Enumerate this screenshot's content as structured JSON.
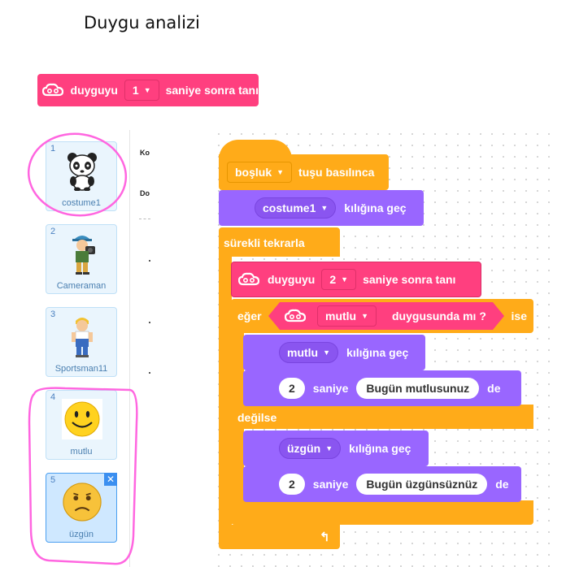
{
  "title": "Duygu analizi",
  "top_block": {
    "label_pre": "duyguyu",
    "value": "1",
    "label_post": "saniye sonra tanı"
  },
  "sprites": [
    {
      "num": "1",
      "name": "costume1"
    },
    {
      "num": "2",
      "name": "Cameraman"
    },
    {
      "num": "3",
      "name": "Sportsman11"
    },
    {
      "num": "4",
      "name": "mutlu"
    },
    {
      "num": "5",
      "name": "üzgün"
    }
  ],
  "side_labels": [
    "Ko",
    "Do"
  ],
  "script": {
    "hat": {
      "key": "boşluk",
      "text": "tuşu basılınca"
    },
    "switch1": {
      "costume": "costume1",
      "text": "kılığına geç"
    },
    "forever": "sürekli tekrarla",
    "recognize": {
      "label_pre": "duyguyu",
      "value": "2",
      "label_post": "saniye sonra tanı"
    },
    "if": {
      "label": "eğer",
      "emotion": "mutlu",
      "text": "duygusunda mı ?",
      "post": "ise"
    },
    "switch_mutlu": {
      "costume": "mutlu",
      "text": "kılığına geç"
    },
    "say_mutlu": {
      "secs": "2",
      "label": "saniye",
      "message": "Bugün mutlusunuz",
      "post": "de"
    },
    "else": "değilse",
    "switch_uzgun": {
      "costume": "üzgün",
      "text": "kılığına geç"
    },
    "say_uzgun": {
      "secs": "2",
      "label": "saniye",
      "message": "Bugün üzgünsüznüz",
      "post": "de"
    }
  },
  "colors": {
    "events": "#ffab19",
    "looks": "#9966ff",
    "extension": "#ff3f7f",
    "highlight": "#ff66e0"
  }
}
